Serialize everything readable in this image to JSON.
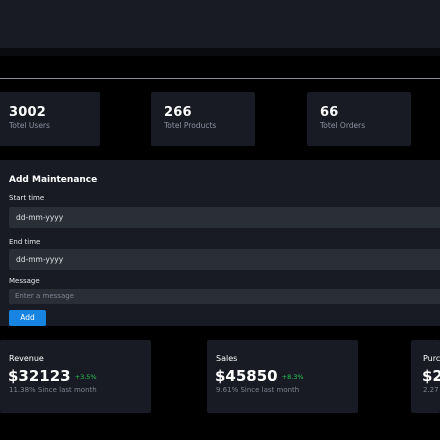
{
  "stats": [
    {
      "value": "3002",
      "label": "Totel Users"
    },
    {
      "value": "266",
      "label": "Totel Products"
    },
    {
      "value": "66",
      "label": "Totel Orders"
    }
  ],
  "maintenance": {
    "title": "Add Maintenance",
    "start_label": "Start time",
    "start_value": "dd-mm-yyyy",
    "end_label": "End time",
    "end_value": "dd-mm-yyyy",
    "message_label": "Message",
    "message_placeholder": "Enter a message",
    "add_label": "Add"
  },
  "kpis": [
    {
      "title": "Revenue",
      "value": "$32123",
      "change": "+3.5%",
      "sub": "11.38% Since last month"
    },
    {
      "title": "Sales",
      "value": "$45850",
      "change": "+8.3%",
      "sub": "9.61% Since last month"
    },
    {
      "title": "Purc",
      "value": "$2",
      "change": "",
      "sub": "2.27"
    }
  ],
  "colors": {
    "background": "#000000",
    "card": "#181b24",
    "input": "#2a2e37",
    "accent": "#1684e0",
    "positive": "#29c24f"
  }
}
